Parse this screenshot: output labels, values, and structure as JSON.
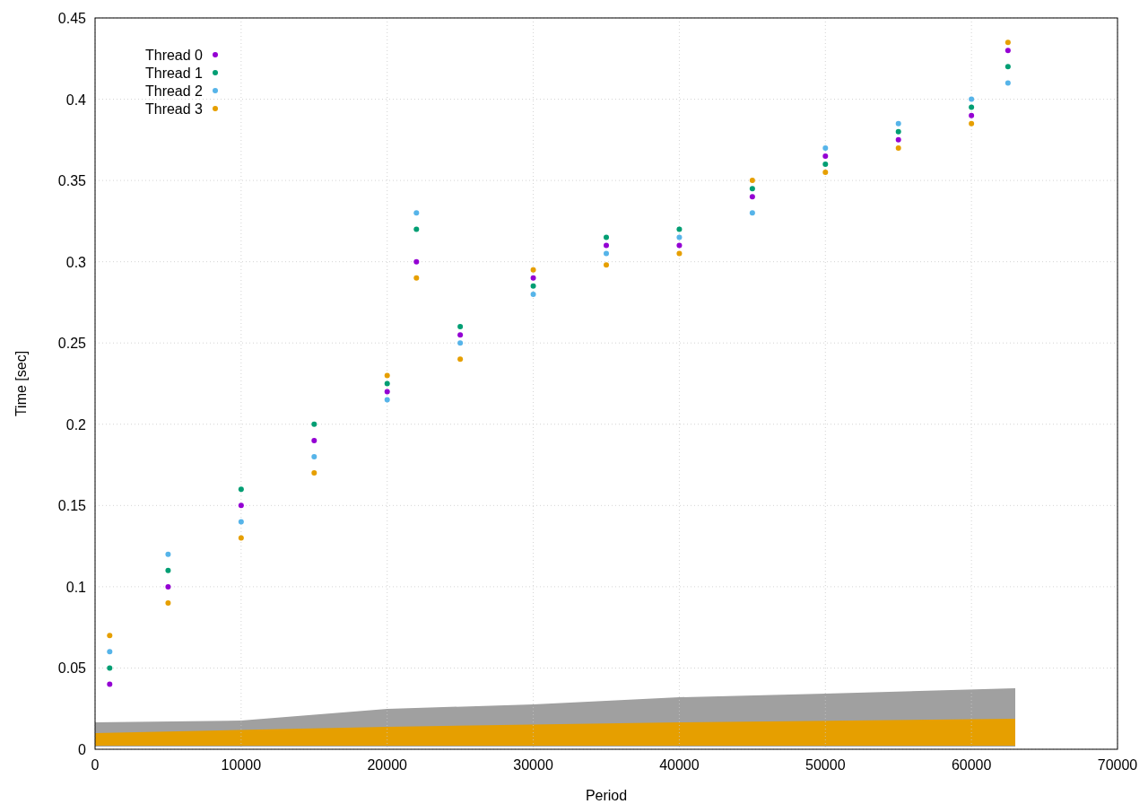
{
  "chart_data": {
    "type": "scatter",
    "grid": true,
    "legend": true,
    "xlabel": "Period",
    "ylabel": "Time [sec]",
    "xlim": [
      0,
      70000
    ],
    "ylim": [
      0,
      0.45
    ],
    "xticks": [
      0,
      10000,
      20000,
      30000,
      40000,
      50000,
      60000,
      70000
    ],
    "yticks": [
      {
        "value": 0,
        "label": "0"
      },
      {
        "value": 0.05,
        "label": "0.05"
      },
      {
        "value": 0.1,
        "label": "0.1"
      },
      {
        "value": 0.15,
        "label": "0.15"
      },
      {
        "value": 0.2,
        "label": "0.2"
      },
      {
        "value": 0.25,
        "label": "0.25"
      },
      {
        "value": 0.3,
        "label": "0.3"
      },
      {
        "value": 0.35,
        "label": "0.35"
      },
      {
        "value": 0.4,
        "label": "0.4"
      },
      {
        "value": 0.45,
        "label": "0.45"
      }
    ],
    "x": [
      1000,
      5000,
      10000,
      15000,
      20000,
      22000,
      25000,
      30000,
      35000,
      40000,
      45000,
      50000,
      55000,
      60000,
      62500
    ],
    "series": [
      {
        "name": "Thread 0",
        "color": "#9400d3",
        "values": [
          0.04,
          0.1,
          0.15,
          0.19,
          0.22,
          0.3,
          0.255,
          0.29,
          0.31,
          0.31,
          0.34,
          0.365,
          0.375,
          0.39,
          0.43
        ]
      },
      {
        "name": "Thread 1",
        "color": "#009e73",
        "values": [
          0.05,
          0.11,
          0.16,
          0.2,
          0.225,
          0.32,
          0.26,
          0.285,
          0.315,
          0.32,
          0.345,
          0.36,
          0.38,
          0.395,
          0.42
        ]
      },
      {
        "name": "Thread 2",
        "color": "#56b4e9",
        "values": [
          0.06,
          0.12,
          0.14,
          0.18,
          0.215,
          0.33,
          0.25,
          0.28,
          0.305,
          0.315,
          0.33,
          0.37,
          0.385,
          0.4,
          0.41
        ]
      },
      {
        "name": "Thread 3",
        "color": "#e69f00",
        "values": [
          0.07,
          0.09,
          0.13,
          0.17,
          0.23,
          0.29,
          0.24,
          0.295,
          0.298,
          0.305,
          0.35,
          0.355,
          0.37,
          0.385,
          0.435
        ]
      }
    ]
  }
}
